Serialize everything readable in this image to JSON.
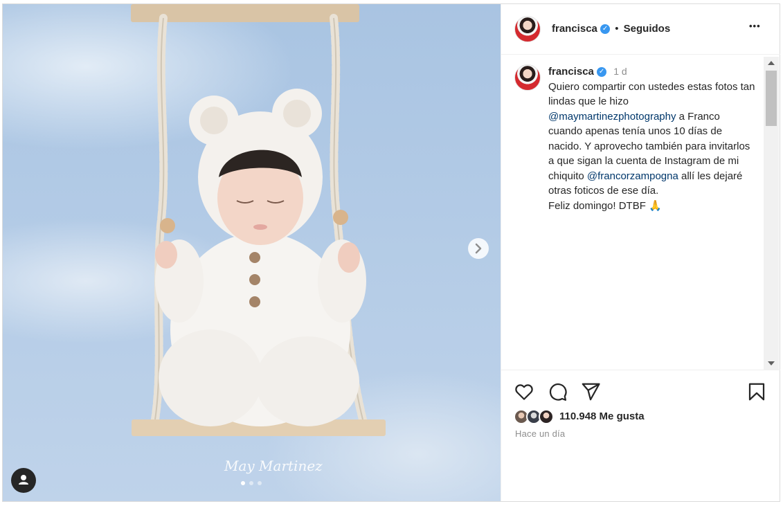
{
  "post": {
    "username": "francisca",
    "verified_mark": "✓",
    "separator": "•",
    "follow_status": "Seguidos",
    "more_glyph": "•••"
  },
  "caption": {
    "username": "francisca",
    "age": "1 d",
    "line1": "Quiero compartir con ustedes estas fotos tan lindas que le hizo",
    "mention1": "@maymartinezphotography",
    "line2": " a Franco cuando apenas tenía unos 10 días de nacido. Y aprovecho también para invitarlos a que sigan la cuenta de Instagram de mi chiquito ",
    "mention2": "@francorzampogna",
    "line3": " allí les dejaré otras foticos de ese día.",
    "line4": "Feliz domingo! DTBF 🙏"
  },
  "engagement": {
    "likes": "110.948 Me gusta",
    "timestamp": "Hace un día"
  },
  "media": {
    "watermark": "May Martinez",
    "carousel_total": 3,
    "carousel_current": 1
  },
  "icons": {
    "like": "heart-icon",
    "comment": "comment-icon",
    "share": "share-icon",
    "save": "bookmark-icon",
    "next": "chevron-right-icon",
    "user": "user-icon"
  },
  "colors": {
    "verified": "#3897f0",
    "link": "#00376b",
    "text": "#262626",
    "muted": "#8e8e8e"
  }
}
